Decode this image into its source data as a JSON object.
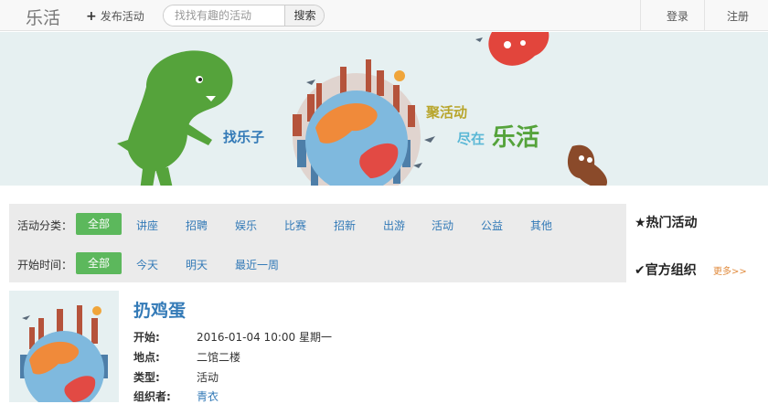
{
  "navbar": {
    "brand": "乐活",
    "publish_label": "发布活动",
    "search_placeholder": "找找有趣的活动",
    "search_button": "搜索",
    "login": "登录",
    "register": "注册"
  },
  "banner": {
    "text1": "找乐子",
    "text2": "聚活动",
    "text3_prefix": "尽在",
    "text3_main": "乐活"
  },
  "filter": {
    "category_label": "活动分类：",
    "categories": [
      "全部",
      "讲座",
      "招聘",
      "娱乐",
      "比赛",
      "招新",
      "出游",
      "活动",
      "公益",
      "其他"
    ],
    "category_selected": "全部",
    "time_label": "开始时间：",
    "times": [
      "全部",
      "今天",
      "明天",
      "最近一周"
    ],
    "time_selected": "全部"
  },
  "sidebar": {
    "hot_title": "★热门活动",
    "org_title": "✔官方组织",
    "more": "更多>>"
  },
  "event": {
    "title": "扔鸡蛋",
    "start_label": "开始:",
    "start_value": "2016-01-04 10:00 星期一",
    "location_label": "地点:",
    "location_value": "二馆二楼",
    "type_label": "类型:",
    "type_value": "活动",
    "organizer_label": "组织者:",
    "organizer_value": "青衣"
  },
  "colors": {
    "accent_green": "#5cb85c",
    "link_blue": "#337ab7",
    "more_orange": "#e08a3c",
    "banner_bg": "#e6f0f1",
    "dino_green": "#55a33b"
  }
}
